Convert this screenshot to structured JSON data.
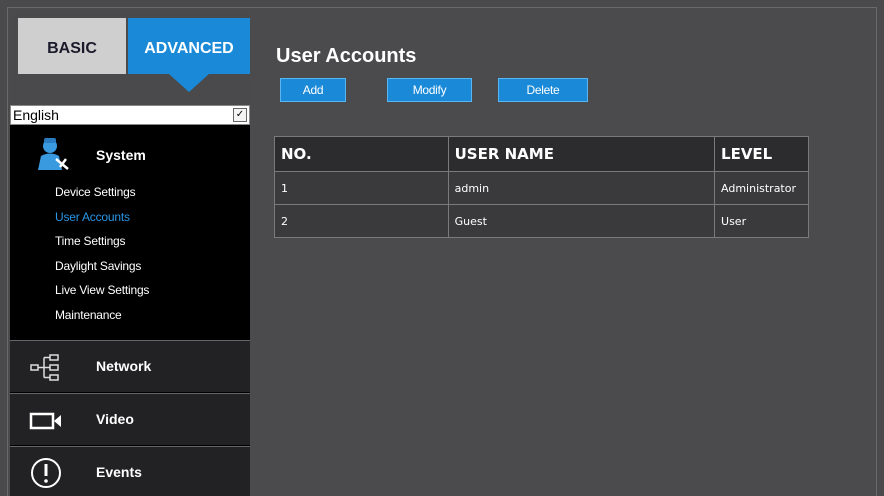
{
  "tabs": {
    "basic": "BASIC",
    "advanced": "ADVANCED"
  },
  "language": {
    "selected": "English"
  },
  "system": {
    "label": "System",
    "items": [
      {
        "label": "Device Settings",
        "active": false
      },
      {
        "label": "User Accounts",
        "active": true
      },
      {
        "label": "Time Settings",
        "active": false
      },
      {
        "label": "Daylight Savings",
        "active": false
      },
      {
        "label": "Live View Settings",
        "active": false
      },
      {
        "label": "Maintenance",
        "active": false
      }
    ]
  },
  "nav": {
    "network": "Network",
    "video": "Video",
    "events": "Events"
  },
  "page": {
    "title": "User Accounts",
    "buttons": {
      "add": "Add",
      "modify": "Modify",
      "delete": "Delete"
    }
  },
  "table": {
    "headers": [
      "NO.",
      "USER NAME",
      "LEVEL"
    ],
    "rows": [
      [
        "1",
        "admin",
        "Administrator"
      ],
      [
        "2",
        "Guest",
        "User"
      ]
    ]
  },
  "colors": {
    "accent": "#1a8ad8",
    "active_link": "#2a96e6",
    "background": "#4a4a4c"
  }
}
